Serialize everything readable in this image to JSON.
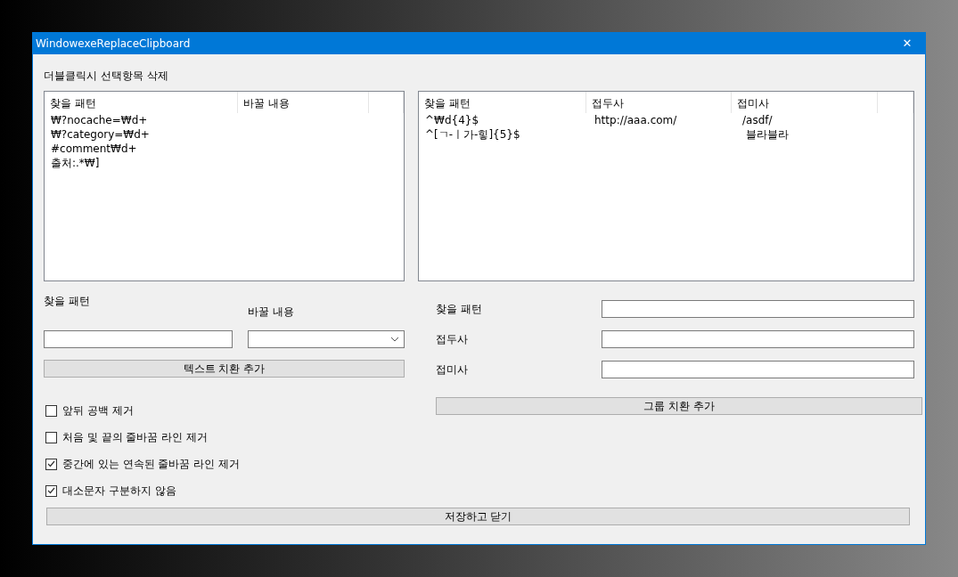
{
  "window": {
    "title": "WindowexeReplaceClipboard",
    "close": "✕"
  },
  "hint": "더블클릭시 선택항목 삭제",
  "text_list": {
    "columns": [
      "찾을 패턴",
      "바꿀 내용"
    ],
    "rows": [
      {
        "pattern": "₩?nocache=₩d+"
      },
      {
        "pattern": "₩?category=₩d+"
      },
      {
        "pattern": "#comment₩d+"
      },
      {
        "pattern": "출처:.*₩]"
      }
    ]
  },
  "group_list": {
    "columns": [
      "찾을 패턴",
      "접두사",
      "접미사"
    ],
    "rows": [
      {
        "pattern": "^₩d{4}$",
        "prefix": "http://aaa.com/",
        "suffix": "/asdf/"
      },
      {
        "pattern": "^[ㄱ-ㅣ가-힣]{5}$",
        "suffix": " 블라블라"
      }
    ]
  },
  "text_form": {
    "pattern_label": "찾을 패턴",
    "replace_label": "바꿀 내용",
    "button": "텍스트 치환 추가"
  },
  "options": [
    {
      "label": "앞뒤 공백 제거",
      "checked": false
    },
    {
      "label": "처음 및 끝의 줄바꿈 라인 제거",
      "checked": false
    },
    {
      "label": "중간에 있는 연속된 줄바꿈 라인 제거",
      "checked": true
    },
    {
      "label": "대소문자 구분하지 않음",
      "checked": true
    }
  ],
  "group_form": {
    "fields": [
      "찾을 패턴",
      "접두사",
      "접미사"
    ],
    "button": "그룹 치환 추가"
  },
  "save_button": "저장하고 닫기"
}
